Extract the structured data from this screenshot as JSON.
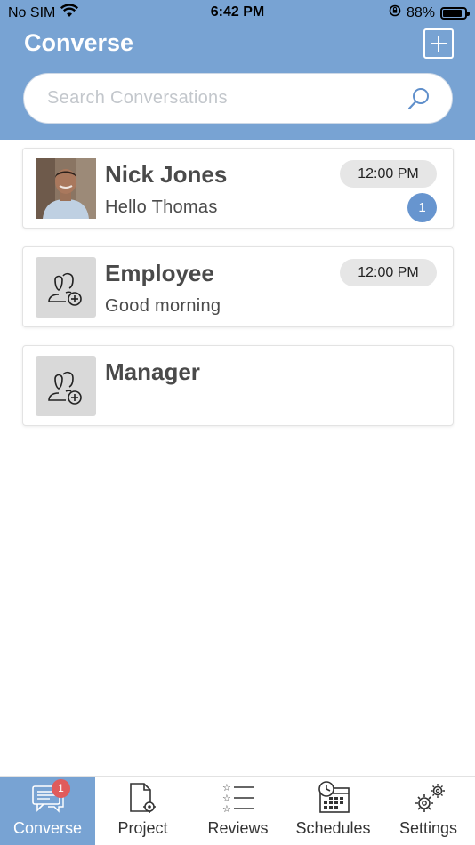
{
  "status_bar": {
    "carrier": "No SIM",
    "time": "6:42 PM",
    "battery_percent": "88%",
    "battery_level": 0.88,
    "icons": [
      "wifi-icon",
      "orientation-lock-icon",
      "battery-icon"
    ]
  },
  "header": {
    "title": "Converse",
    "add_icon": "plus-square-icon"
  },
  "search": {
    "placeholder": "Search Conversations",
    "icon": "search-icon"
  },
  "conversations": [
    {
      "name": "Nick Jones",
      "preview": "Hello Thomas",
      "time": "12:00 PM",
      "unread": "1",
      "avatar": "photo"
    },
    {
      "name": "Employee",
      "preview": "Good morning",
      "time": "12:00 PM",
      "unread": null,
      "avatar": "add-user-icon"
    },
    {
      "name": "Manager",
      "preview": "",
      "time": null,
      "unread": null,
      "avatar": "add-user-icon"
    }
  ],
  "tabbar": {
    "items": [
      {
        "label": "Converse",
        "icon": "chat-icon",
        "badge": "1",
        "active": true
      },
      {
        "label": "Project",
        "icon": "document-settings-icon",
        "active": false
      },
      {
        "label": "Reviews",
        "icon": "star-list-icon",
        "active": false
      },
      {
        "label": "Schedules",
        "icon": "calendar-clock-icon",
        "active": false
      },
      {
        "label": "Settings",
        "icon": "gears-icon",
        "active": false
      }
    ]
  },
  "colors": {
    "accent": "#78a3d3",
    "badge_blue": "#6795cf",
    "badge_red": "#e05b5b"
  }
}
